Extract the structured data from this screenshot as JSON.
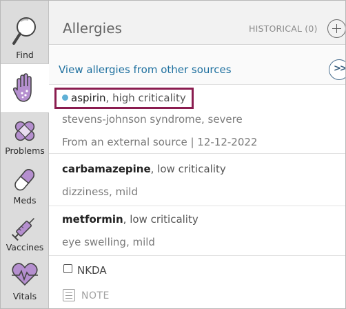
{
  "sidebar": {
    "items": [
      {
        "label": "Find",
        "icon": "magnifier-icon"
      },
      {
        "label": "",
        "icon": "allergy-hand-icon",
        "active": true
      },
      {
        "label": "Problems",
        "icon": "bandage-icon"
      },
      {
        "label": "Meds",
        "icon": "pill-icon"
      },
      {
        "label": "Vaccines",
        "icon": "syringe-icon"
      },
      {
        "label": "Vitals",
        "icon": "heart-pulse-icon"
      }
    ]
  },
  "header": {
    "title": "Allergies",
    "historical_label": "HISTORICAL (0)",
    "add_icon": "plus-circle-icon"
  },
  "other_sources": {
    "link_text": "View allergies from other sources",
    "more_icon": "double-chevron-right-icon"
  },
  "allergies": [
    {
      "drug": "aspirin",
      "criticality": ", high criticality",
      "reaction": "stevens-johnson syndrome, severe",
      "source": "From an external source |  12-12-2022",
      "external": true
    },
    {
      "drug": "carbamazepine",
      "criticality": ", low criticality",
      "reaction": "dizziness, mild"
    },
    {
      "drug": "metformin",
      "criticality": ", low criticality",
      "reaction": "eye swelling, mild"
    }
  ],
  "nkda": {
    "label": "NKDA",
    "checked": false
  },
  "note": {
    "label": "NOTE"
  },
  "colors": {
    "accent_link": "#1d6f9e",
    "highlight_border": "#8a1c4f",
    "icon_purple": "#b58fcf",
    "external_dot": "#5fb0d6"
  }
}
